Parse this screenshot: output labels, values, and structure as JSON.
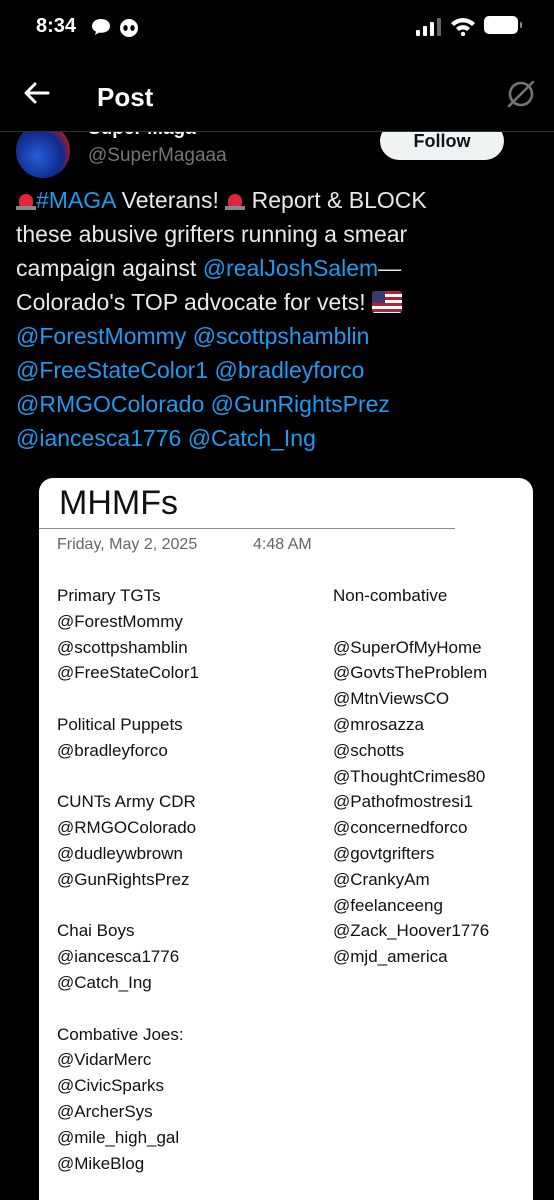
{
  "status_bar": {
    "time": "8:34"
  },
  "header": {
    "title": "Post"
  },
  "author": {
    "name": "Super Maga",
    "handle": "@SuperMagaaa",
    "follow_label": "Follow"
  },
  "tweet": {
    "line1": {
      "hashtag": "#MAGA",
      "text_a": " Veterans! ",
      "text_b": " Report & BLOCK"
    },
    "line2": "these abusive grifters running a smear",
    "line3": {
      "text": "campaign against ",
      "mention": "@realJoshSalem",
      "tail": "—"
    },
    "line4": "Colorado's TOP advocate for vets! ",
    "mentions": [
      [
        "@ForestMommy",
        "@scottpshamblin"
      ],
      [
        "@FreeStateColor1",
        "@bradleyforco"
      ],
      [
        "@RMGOColorado",
        "@GunRightsPrez"
      ],
      [
        "@iancesca1776",
        "@Catch_Ing"
      ]
    ]
  },
  "document": {
    "title": "MHMFs",
    "date": "Friday, May 2, 2025",
    "time": "4:48 AM",
    "left_column": [
      "Primary TGTs",
      "@ForestMommy",
      "@scottpshamblin",
      "@FreeStateColor1",
      "",
      "Political Puppets",
      "@bradleyforco",
      "",
      "CUNTs Army CDR",
      "@RMGOColorado",
      "@dudleywbrown",
      "@GunRightsPrez",
      "",
      "Chai Boys",
      "@iancesca1776",
      "@Catch_Ing",
      "",
      "Combative Joes:",
      "@VidarMerc",
      "@CivicSparks",
      "@ArcherSys",
      "@mile_high_gal",
      "@MikeBlog"
    ],
    "right_column": [
      "Non-combative",
      "",
      "@SuperOfMyHome",
      "@GovtsTheProblem",
      "@MtnViewsCO",
      "@mrosazza",
      "@schotts",
      "@ThoughtCrimes80",
      "@Pathofmostresi1",
      "@concernedforco",
      "@govtgrifters",
      "@CrankyAm",
      "@feelanceeng",
      "@Zack_Hoover1776",
      "@mjd_america"
    ]
  },
  "icons": {
    "back": "arrow-left-icon",
    "grok": "grok-icon",
    "siren": "rotating-light-emoji",
    "flag": "us-flag-emoji"
  },
  "colors": {
    "accent": "#1d9bf0",
    "background": "#000000",
    "text": "#e7e9ea",
    "muted": "#71767b"
  }
}
